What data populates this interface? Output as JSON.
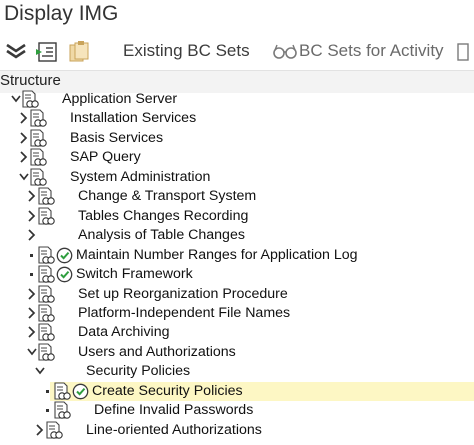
{
  "window": {
    "title": "Display IMG"
  },
  "toolbar": {
    "existing_bc_sets": "Existing BC Sets",
    "bc_sets_for_activity": "BC Sets for Activity"
  },
  "structure_label": "Structure",
  "tree": [
    {
      "id": "application-server",
      "label": "Application Server",
      "level": 0,
      "toggle": "expanded",
      "clock": false,
      "selected": false
    },
    {
      "id": "installation-services",
      "label": "Installation Services",
      "level": 1,
      "toggle": "collapsed",
      "clock": false,
      "selected": false
    },
    {
      "id": "basis-services",
      "label": "Basis Services",
      "level": 1,
      "toggle": "collapsed",
      "clock": false,
      "selected": false
    },
    {
      "id": "sap-query",
      "label": "SAP Query",
      "level": 1,
      "toggle": "collapsed",
      "clock": false,
      "selected": false
    },
    {
      "id": "system-administration",
      "label": "System Administration",
      "level": 1,
      "toggle": "expanded",
      "clock": false,
      "selected": false
    },
    {
      "id": "change-transport-system",
      "label": "Change & Transport System",
      "level": 2,
      "toggle": "collapsed",
      "clock": false,
      "selected": false
    },
    {
      "id": "tables-changes-recording",
      "label": "Tables Changes Recording",
      "level": 2,
      "toggle": "collapsed",
      "clock": false,
      "selected": false
    },
    {
      "id": "analysis-of-table-changes",
      "label": "Analysis of Table Changes",
      "level": 2,
      "toggle": "collapsed",
      "clock": false,
      "selected": false,
      "no_doc": true
    },
    {
      "id": "maintain-number-ranges",
      "label": "Maintain Number Ranges for Application Log",
      "level": 2,
      "toggle": "leaf",
      "clock": true,
      "selected": false
    },
    {
      "id": "switch-framework",
      "label": "Switch Framework",
      "level": 2,
      "toggle": "leaf",
      "clock": true,
      "selected": false
    },
    {
      "id": "set-up-reorganization",
      "label": "Set up Reorganization Procedure",
      "level": 2,
      "toggle": "collapsed",
      "clock": false,
      "selected": false
    },
    {
      "id": "platform-independent-file-names",
      "label": "Platform-Independent File Names",
      "level": 2,
      "toggle": "collapsed",
      "clock": false,
      "selected": false
    },
    {
      "id": "data-archiving",
      "label": "Data Archiving",
      "level": 2,
      "toggle": "collapsed",
      "clock": false,
      "selected": false
    },
    {
      "id": "users-and-authorizations",
      "label": "Users and Authorizations",
      "level": 2,
      "toggle": "expanded",
      "clock": false,
      "selected": false
    },
    {
      "id": "security-policies",
      "label": "Security Policies",
      "level": 3,
      "toggle": "expanded",
      "clock": false,
      "selected": false,
      "no_doc": true
    },
    {
      "id": "create-security-policies",
      "label": "Create Security Policies",
      "level": 4,
      "toggle": "leaf",
      "clock": true,
      "selected": true
    },
    {
      "id": "define-invalid-passwords",
      "label": "Define Invalid Passwords",
      "level": 4,
      "toggle": "leaf",
      "clock": false,
      "selected": false,
      "no_doc": false
    },
    {
      "id": "line-oriented-authorizations",
      "label": "Line-oriented Authorizations",
      "level": 3,
      "toggle": "collapsed",
      "clock": false,
      "selected": false
    }
  ]
}
